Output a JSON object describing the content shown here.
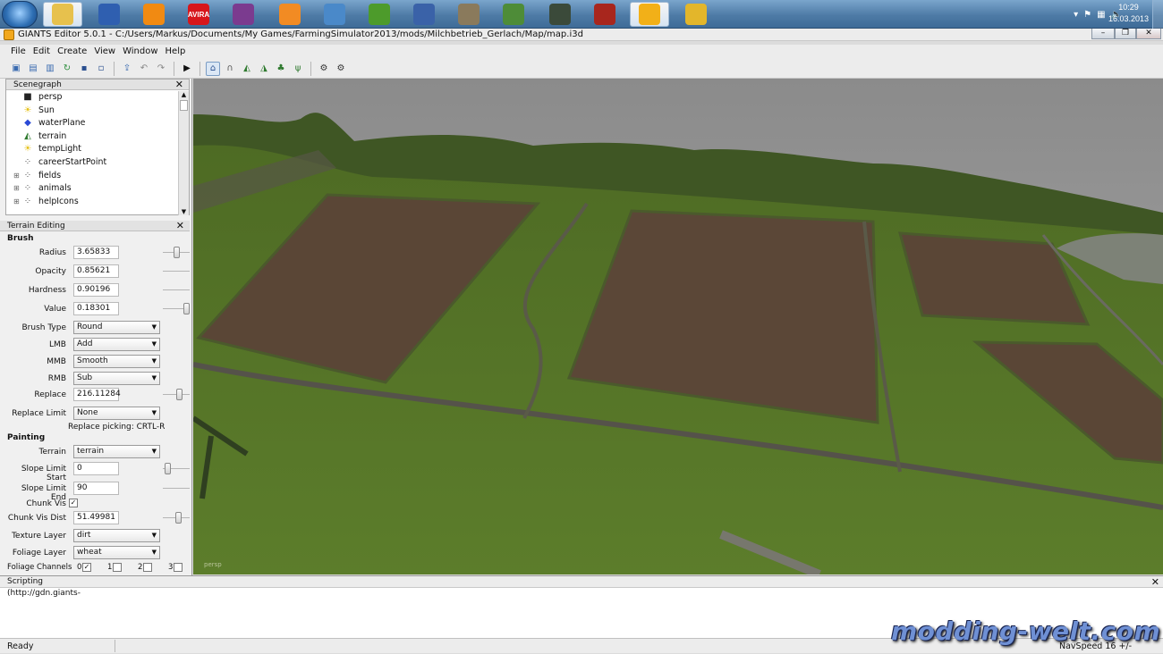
{
  "taskbar": {
    "apps": [
      {
        "icon": "windows-explorer-icon",
        "color": "#e7c14d",
        "active": true
      },
      {
        "icon": "thunderbird-icon",
        "color": "#2f5fb0"
      },
      {
        "icon": "vlc-icon",
        "color": "#f18a12"
      },
      {
        "icon": "avira-icon",
        "color": "#d7161b",
        "text": "AVIRA"
      },
      {
        "icon": "winrar-icon",
        "color": "#7b3b8f"
      },
      {
        "icon": "presentation-icon",
        "color": "#f28b23"
      },
      {
        "icon": "antivirus-icon",
        "color": "#4a89c9"
      },
      {
        "icon": "utorrent-icon",
        "color": "#4d9b2b"
      },
      {
        "icon": "notepad-icon",
        "color": "#3a62a8"
      },
      {
        "icon": "gimp-icon",
        "color": "#8a7a5c"
      },
      {
        "icon": "chart-tool-icon",
        "color": "#4e8c38"
      },
      {
        "icon": "tractor-icon",
        "color": "#3b4a3a"
      },
      {
        "icon": "farming-simulator-icon",
        "color": "#a8261d"
      },
      {
        "icon": "giants-editor-icon",
        "color": "#f2b018",
        "active": true
      },
      {
        "icon": "dev-tools-icon",
        "color": "#e3b62b"
      }
    ],
    "clock_time": "10:29",
    "clock_date": "16.03.2013"
  },
  "window": {
    "title": "GIANTS Editor 5.0.1 - C:/Users/Markus/Documents/My Games/FarmingSimulator2013/mods/Milchbetrieb_Gerlach/Map/map.i3d"
  },
  "menu": [
    "File",
    "Edit",
    "Create",
    "View",
    "Window",
    "Help"
  ],
  "scenegraph": {
    "title": "Scenegraph",
    "items": [
      {
        "label": "persp",
        "icon": "camera-icon",
        "expandable": false
      },
      {
        "label": "Sun",
        "icon": "light-icon",
        "expandable": false
      },
      {
        "label": "waterPlane",
        "icon": "cube-icon",
        "expandable": false
      },
      {
        "label": "terrain",
        "icon": "terrain-icon",
        "expandable": false
      },
      {
        "label": "tempLight",
        "icon": "light-icon",
        "expandable": false
      },
      {
        "label": "careerStartPoint",
        "icon": "transform-group-icon",
        "expandable": false
      },
      {
        "label": "fields",
        "icon": "transform-group-icon",
        "expandable": true
      },
      {
        "label": "animals",
        "icon": "transform-group-icon",
        "expandable": true
      },
      {
        "label": "helpIcons",
        "icon": "transform-group-icon",
        "expandable": true
      }
    ]
  },
  "terrain_editing": {
    "title": "Terrain Editing",
    "brush_section": "Brush",
    "radius_label": "Radius",
    "radius_value": "3.65833",
    "radius_level": 0.5,
    "opacity_label": "Opacity",
    "opacity_value": "0.85621",
    "hardness_label": "Hardness",
    "hardness_value": "0.90196",
    "value_label": "Value",
    "value_value": "0.18301",
    "value_level": 1.0,
    "brush_type_label": "Brush Type",
    "brush_type_value": "Round",
    "lmb_label": "LMB",
    "lmb_value": "Add",
    "mmb_label": "MMB",
    "mmb_value": "Smooth",
    "rmb_label": "RMB",
    "rmb_value": "Sub",
    "replace_label": "Replace",
    "replace_value": "216.11284",
    "replace_level": 0.65,
    "replace_limit_label": "Replace Limit",
    "replace_limit_value": "None",
    "replace_picking_hint": "Replace picking: CRTL-R",
    "painting_section": "Painting",
    "terrain_label": "Terrain",
    "terrain_value": "terrain",
    "slope_start_label": "Slope Limit Start",
    "slope_start_value": "0",
    "slope_start_level": 0.1,
    "slope_end_label": "Slope Limit End",
    "slope_end_value": "90",
    "chunk_vis_label": "Chunk Vis",
    "chunk_vis_checked": true,
    "chunk_vis_dist_label": "Chunk Vis Dist",
    "chunk_vis_dist_value": "51.49981",
    "chunk_vis_dist_level": 0.6,
    "texture_layer_label": "Texture Layer",
    "texture_layer_value": "dirt",
    "foliage_layer_label": "Foliage Layer",
    "foliage_layer_value": "wheat",
    "foliage_channels_label": "Foliage Channels",
    "foliage_channels": [
      {
        "index": "0",
        "checked": true
      },
      {
        "index": "1",
        "checked": false
      },
      {
        "index": "2",
        "checked": false
      },
      {
        "index": "3",
        "checked": false
      }
    ]
  },
  "viewport": {
    "camera_label": "persp"
  },
  "scripting": {
    "title": "Scripting",
    "log_line": "(http://gdn.giants-"
  },
  "status": {
    "text": "Ready",
    "nav_speed": "NavSpeed 16 +/-"
  },
  "watermark": "modding-welt.com"
}
